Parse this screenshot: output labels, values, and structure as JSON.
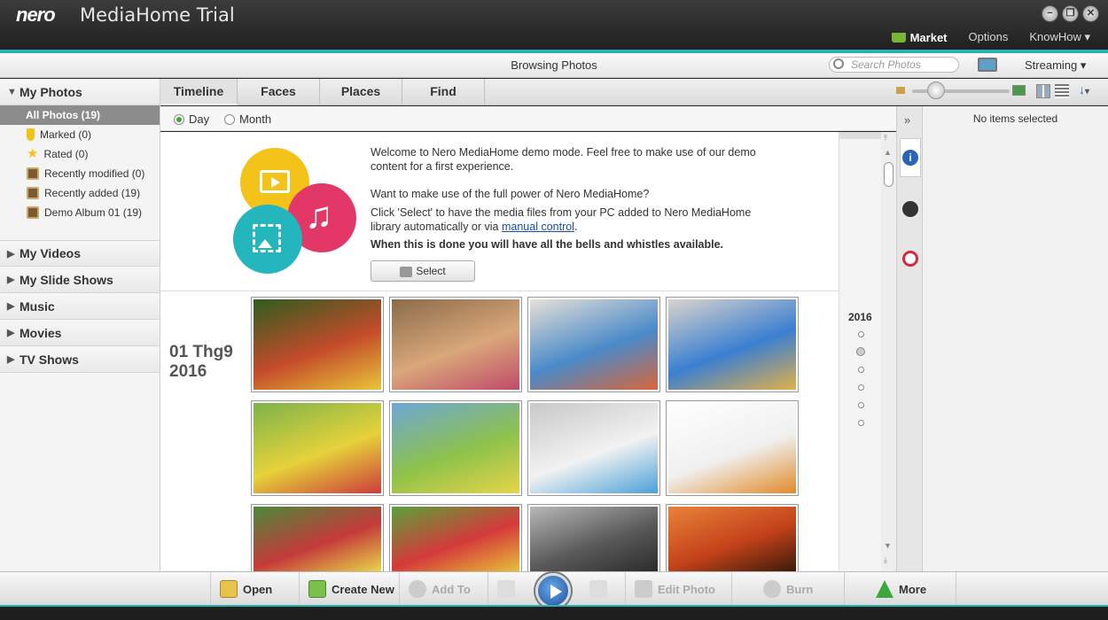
{
  "app": {
    "brand": "nero",
    "title": "MediaHome Trial"
  },
  "window_controls": {
    "minimize": "−",
    "restore": "❐",
    "close": "✕"
  },
  "top_menu": {
    "market": "Market",
    "options": "Options",
    "knowhow": "KnowHow ▾"
  },
  "header": {
    "browsing": "Browsing Photos",
    "search_placeholder": "Search Photos",
    "streaming": "Streaming ▾"
  },
  "sidebar": {
    "my_photos": "My Photos",
    "all_photos": "All Photos (19)",
    "items": [
      {
        "label": "Marked (0)",
        "icon": "marked-icon",
        "color": "#f2c21b"
      },
      {
        "label": "Rated (0)",
        "icon": "star-icon",
        "color": "#f4d03f"
      },
      {
        "label": "Recently modified (0)",
        "icon": "album-icon",
        "color": "#7a5a2e"
      },
      {
        "label": "Recently added (19)",
        "icon": "album-icon",
        "color": "#7a5a2e"
      },
      {
        "label": "Demo Album 01 (19)",
        "icon": "album-icon",
        "color": "#7a5a2e"
      }
    ],
    "sections": [
      "My Videos",
      "My Slide Shows",
      "Music",
      "Movies",
      "TV Shows"
    ]
  },
  "tabs": [
    "Timeline",
    "Faces",
    "Places",
    "Find"
  ],
  "view_mode": {
    "day": "Day",
    "month": "Month"
  },
  "welcome": {
    "line1": "Welcome to Nero MediaHome demo mode. Feel free to make use of our demo content for a first experience.",
    "line2": "Want to make use of the full power of Nero MediaHome?",
    "line3a": "Click 'Select' to have the media files from your PC added to Nero MediaHome library automatically or via ",
    "link": "manual control",
    "line3b": ".",
    "line4": "When this is done you will have all the bells and whistles available.",
    "select_button": "Select"
  },
  "date_group": {
    "day": "01 Thg9",
    "year": "2016"
  },
  "photos": [
    {
      "name": "school-kids",
      "colors": [
        "#2e5d1e",
        "#c44b2a",
        "#e8c53a"
      ]
    },
    {
      "name": "kids-group-wood",
      "colors": [
        "#8a6b4a",
        "#d9a77a",
        "#c04a6a"
      ]
    },
    {
      "name": "kids-drawing",
      "colors": [
        "#e6e0d8",
        "#4a8ac9",
        "#d8673a"
      ]
    },
    {
      "name": "kids-table",
      "colors": [
        "#dad4cc",
        "#3b7fd1",
        "#e2b04a"
      ]
    },
    {
      "name": "kids-running-meadow",
      "colors": [
        "#7cb34a",
        "#e6d23a",
        "#cc3b3b"
      ]
    },
    {
      "name": "kids-field",
      "colors": [
        "#6da6d8",
        "#8ec24a",
        "#e6d44a"
      ]
    },
    {
      "name": "karate-kids-blue",
      "colors": [
        "#c8c8c8",
        "#f2f2f2",
        "#4aa0d8"
      ]
    },
    {
      "name": "karate-kids-white",
      "colors": [
        "#ffffff",
        "#f0f0f0",
        "#e28a2a"
      ]
    },
    {
      "name": "kids-trees",
      "colors": [
        "#4a8a3a",
        "#c43a3a",
        "#e8d84a"
      ]
    },
    {
      "name": "girl-ball",
      "colors": [
        "#5aa23a",
        "#d43a3a",
        "#e8c23a"
      ]
    },
    {
      "name": "mountain-bw",
      "colors": [
        "#b8b8b8",
        "#5a5a5a",
        "#2a2a2a"
      ]
    },
    {
      "name": "desert-sunset",
      "colors": [
        "#e8823a",
        "#c4421a",
        "#3a1a0a"
      ]
    }
  ],
  "timeline": {
    "year": "2016"
  },
  "info_panel": {
    "no_items": "No items selected"
  },
  "bottom": {
    "open": "Open",
    "create_new": "Create New",
    "add_to": "Add To",
    "edit_photo": "Edit Photo",
    "burn": "Burn",
    "more": "More"
  }
}
